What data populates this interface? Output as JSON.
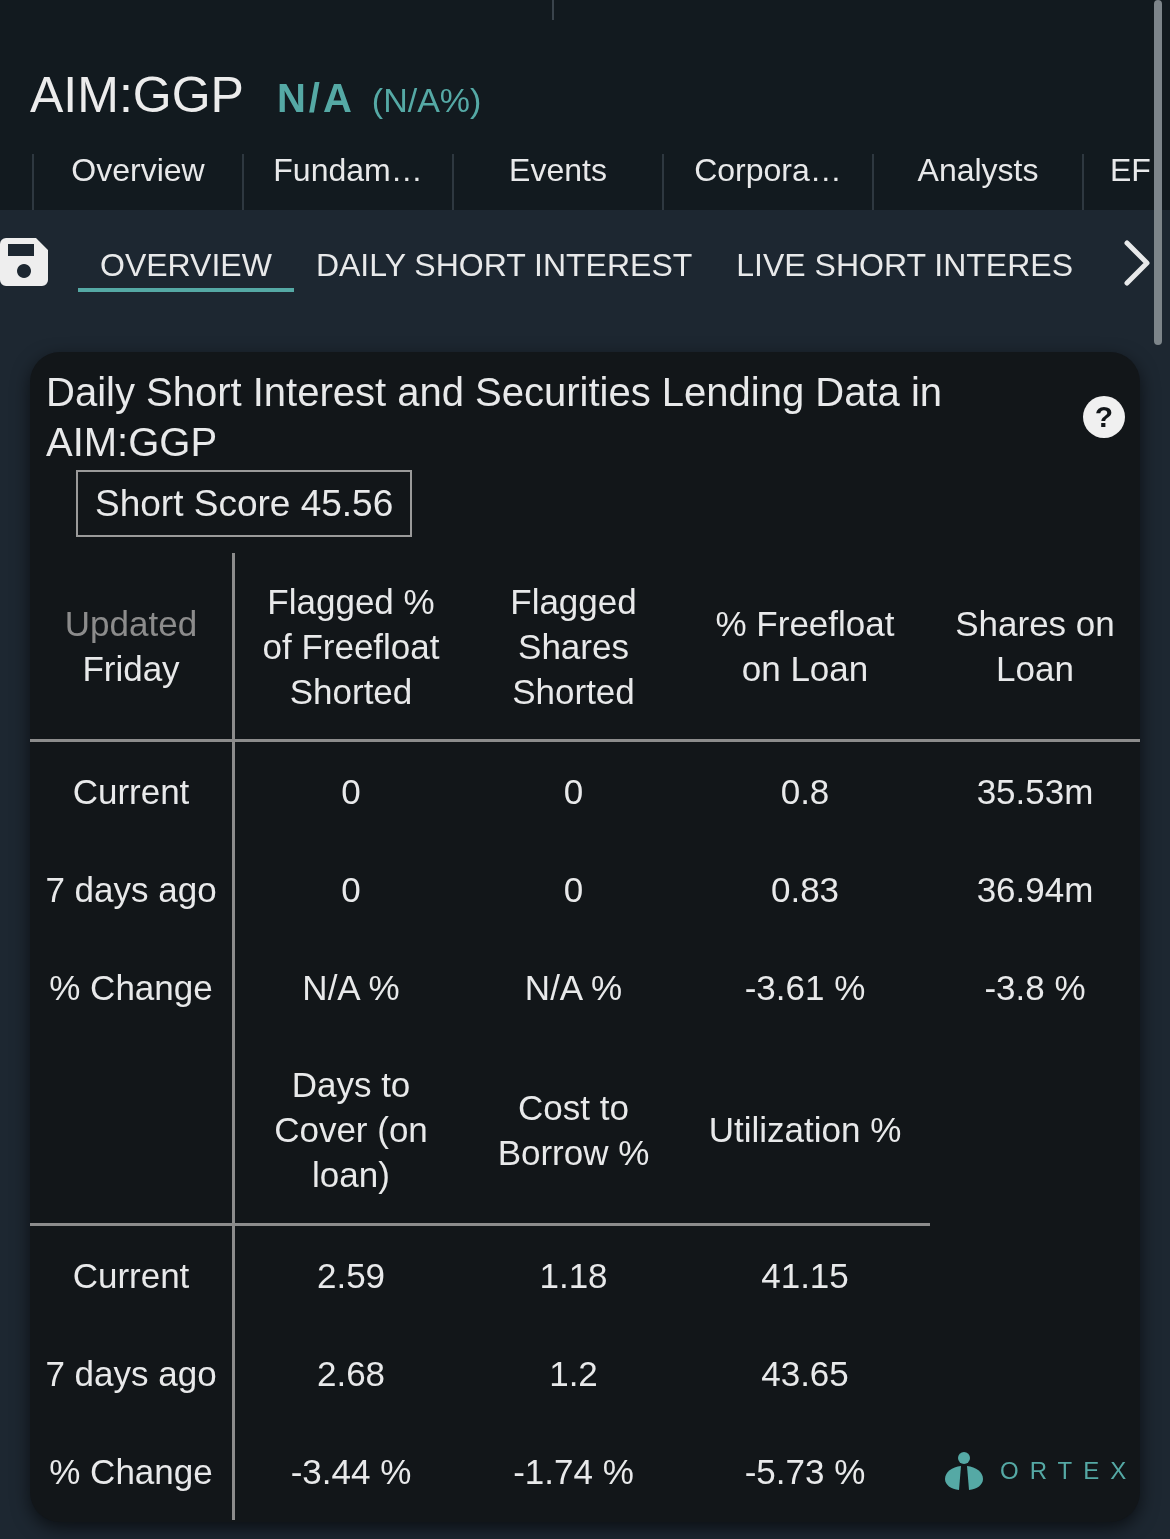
{
  "header": {
    "symbol": "AIM:GGP",
    "price": "N/A",
    "change": "(N/A%)"
  },
  "nav_tabs": [
    {
      "label": "Overview",
      "selected": false
    },
    {
      "label": "Fundam…",
      "selected": false
    },
    {
      "label": "Events",
      "selected": false
    },
    {
      "label": "Corpora…",
      "selected": false
    },
    {
      "label": "Analysts",
      "selected": false
    },
    {
      "label": "EF",
      "selected": false
    }
  ],
  "sub_tabs": [
    {
      "label": "OVERVIEW",
      "selected": true
    },
    {
      "label": "DAILY SHORT INTEREST",
      "selected": false
    },
    {
      "label": "LIVE SHORT INTERES",
      "selected": false
    }
  ],
  "card": {
    "title": "Daily Short Interest and Securities Lending Data in AIM:GGP",
    "help_button": "?",
    "short_score": "Short Score 45.56",
    "tables": [
      {
        "corner": {
          "label": "Updated",
          "value": "Friday"
        },
        "columns": [
          "Flagged % of Freefloat Shorted",
          "Flagged Shares Shorted",
          "% Freefloat on Loan",
          "Shares on Loan"
        ],
        "rows": [
          {
            "label": "Current",
            "cells": [
              "0",
              "0",
              "0.8",
              "35.53m"
            ]
          },
          {
            "label": "7 days ago",
            "cells": [
              "0",
              "0",
              "0.83",
              "36.94m"
            ]
          },
          {
            "label": "% Change",
            "cells": [
              "N/A %",
              "N/A %",
              "-3.61 %",
              "-3.8 %"
            ]
          }
        ]
      },
      {
        "columns": [
          "Days to Cover (on loan)",
          "Cost to Borrow %",
          "Utilization %"
        ],
        "rows": [
          {
            "label": "Current",
            "cells": [
              "2.59",
              "1.18",
              "41.15"
            ]
          },
          {
            "label": "7 days ago",
            "cells": [
              "2.68",
              "1.2",
              "43.65"
            ]
          },
          {
            "label": "% Change",
            "cells": [
              "-3.44 %",
              "-1.74 %",
              "-5.73 %"
            ]
          }
        ]
      }
    ]
  },
  "brand": {
    "name": "ORTEX"
  }
}
